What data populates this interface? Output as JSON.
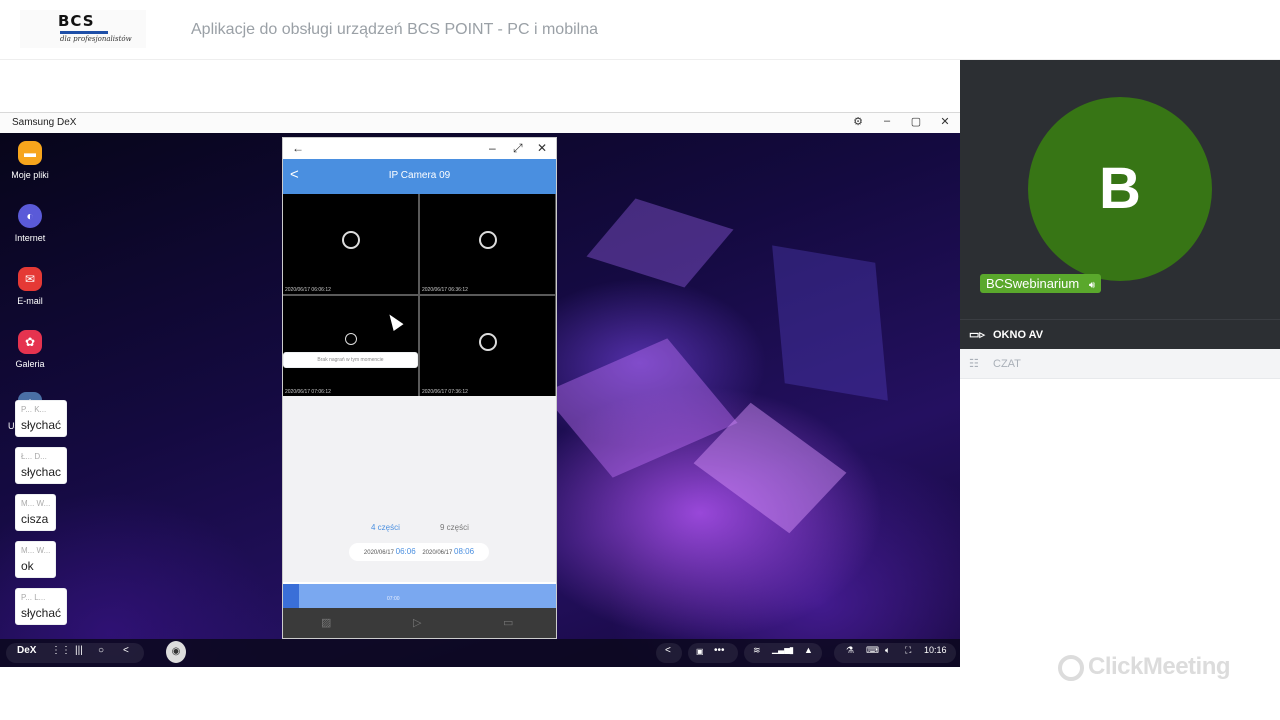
{
  "header": {
    "logo_brand": "BCS",
    "logo_tagline": "dla profesjonalistów",
    "title": "Aplikacje do obsługi urządzeń BCS POINT - PC i mobilna"
  },
  "dex_window": {
    "title": "Samsung DeX",
    "controls": [
      "⚙",
      "–",
      "▢",
      "✕"
    ]
  },
  "desktop_apps": [
    {
      "label": "Moje pliki",
      "icon": "folder-icon",
      "color": "#f7a51c"
    },
    {
      "label": "Internet",
      "icon": "internet-icon",
      "color": "#5a5ad8"
    },
    {
      "label": "E-mail",
      "icon": "email-icon",
      "color": "#e53935"
    },
    {
      "label": "Galeria",
      "icon": "gallery-icon",
      "color": "#e5334f"
    },
    {
      "label": "Ustawienia",
      "icon": "settings-icon",
      "color": "#4a6fa5"
    }
  ],
  "phone_app": {
    "window_back": "←",
    "window_min": "–",
    "window_max": "⤢",
    "window_close": "✕",
    "header_back": "<",
    "header_title": "IP Camera 09",
    "cells": [
      {
        "timestamp": "2020/06/17 06:06:12",
        "message": ""
      },
      {
        "timestamp": "2020/06/17 06:36:12",
        "message": ""
      },
      {
        "timestamp": "2020/06/17 07:06:12",
        "message": "Brak nagrań w tym momencie"
      },
      {
        "timestamp": "2020/06/17 07:36:12",
        "message": ""
      }
    ],
    "split_options": [
      "4 części",
      "9 części"
    ],
    "selected_split": "4 części",
    "range_start_date": "2020/06/17",
    "range_start_time": "06:06",
    "range_end_date": "2020/06/17",
    "range_end_time": "08:06",
    "timeline_time": "07:00"
  },
  "taskbar": {
    "dex_label": "DeX",
    "clock": "10:16"
  },
  "av_panel": {
    "avatar_letter": "B",
    "participant_name": "BCSwebinarium",
    "section_label": "OKNO AV",
    "avatar_color": "#377515"
  },
  "chat": {
    "section_label": "CZAT",
    "messages": [
      {
        "author": "P... K...",
        "text": "słychać"
      },
      {
        "author": "Ł... D...",
        "text": "słychac"
      },
      {
        "author": "M... W...",
        "text": "cisza"
      },
      {
        "author": "M... W...",
        "text": "ok"
      },
      {
        "author": "P... L...",
        "text": "słychać"
      }
    ]
  },
  "watermark": "ClickMeeting"
}
